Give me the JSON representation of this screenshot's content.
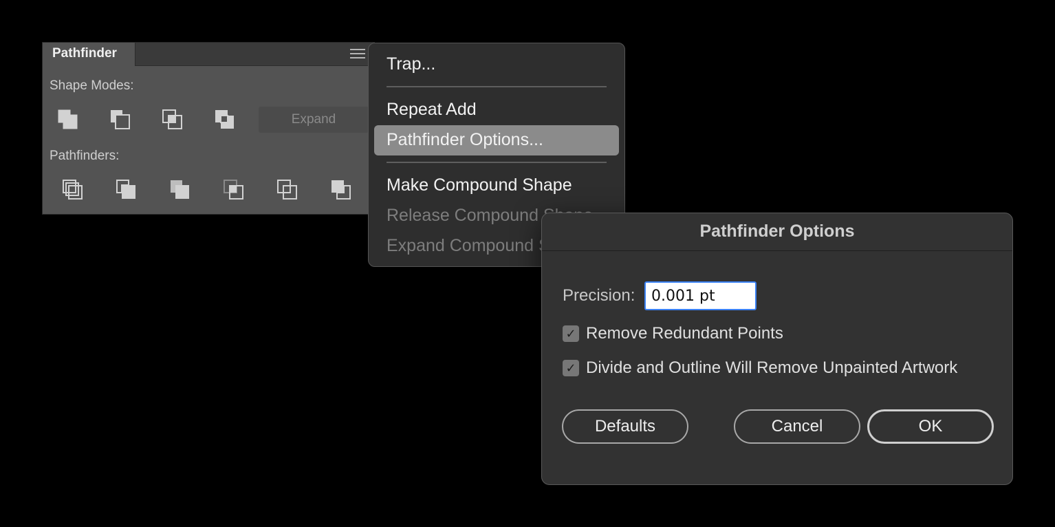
{
  "pathfinder_panel": {
    "tab_title": "Pathfinder",
    "menu_icon": "hamburger-icon",
    "shape_modes_label": "Shape Modes:",
    "expand_label": "Expand",
    "pathfinders_label": "Pathfinders:",
    "shape_mode_icons": [
      "unite-icon",
      "minus-front-icon",
      "intersect-icon",
      "exclude-icon"
    ],
    "pathfinder_icons": [
      "divide-icon",
      "trim-icon",
      "merge-icon",
      "crop-icon",
      "outline-icon",
      "minus-back-icon"
    ]
  },
  "flyout_menu": {
    "items": [
      {
        "label": "Trap...",
        "enabled": true
      },
      {
        "label": "Repeat Add",
        "enabled": true
      },
      {
        "label": "Pathfinder Options...",
        "enabled": true,
        "highlighted": true
      },
      {
        "label": "Make Compound Shape",
        "enabled": true
      },
      {
        "label": "Release Compound Shape",
        "enabled": false
      },
      {
        "label": "Expand Compound Shape",
        "enabled": false
      }
    ]
  },
  "dialog": {
    "title": "Pathfinder Options",
    "precision_label": "Precision:",
    "precision_value": "0.001 pt",
    "remove_redundant_label": "Remove Redundant Points",
    "remove_redundant_checked": true,
    "divide_outline_label": "Divide and Outline Will Remove Unpainted Artwork",
    "divide_outline_checked": true,
    "defaults_label": "Defaults",
    "cancel_label": "Cancel",
    "ok_label": "OK"
  },
  "colors": {
    "panel_bg": "#535353",
    "menu_bg": "#2e2e2e",
    "dialog_bg": "#323232",
    "highlight": "#8b8b8b",
    "focus_ring": "#3b82f6"
  }
}
